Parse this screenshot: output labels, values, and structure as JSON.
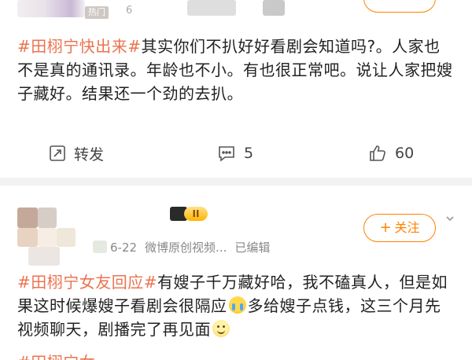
{
  "post1": {
    "hot_badge": "热门",
    "time_fragment": "6",
    "content": {
      "hashtag": "#田栩宁快出来#",
      "text": "其实你们不扒好好看剧会知道吗?。人家也不是真的通讯录。年龄也不小。有也很正常吧。说让人家把嫂子藏好。结果还一个劲的去扒。"
    },
    "actions": {
      "repost_label": "转发",
      "comment_count": "5",
      "like_count": "60"
    }
  },
  "post2": {
    "badge_text": "II",
    "follow_label": "关注",
    "meta": {
      "date": "6-22",
      "source": "微博原创视频...",
      "edited": "已编辑"
    },
    "content": {
      "hashtag": "#田栩宁女友回应#",
      "text_a": "有嫂子千万藏好哈，我不磕真人，但是如果这时候爆嫂子看剧会很隔应",
      "text_b": "多给嫂子点钱，这三个月先视频聊天，剧播完了再见面"
    },
    "partial_next_line": "#田栩宁女"
  },
  "icons": [
    "share-icon",
    "comment-icon",
    "like-icon",
    "chevron-down-icon",
    "crying-emoji-icon",
    "smile-emoji-icon"
  ],
  "colors": {
    "accent": "#ff8200",
    "hashtag": "#eb7350",
    "divider": "#f2f2f2",
    "text": "#222222",
    "muted": "#888888"
  }
}
